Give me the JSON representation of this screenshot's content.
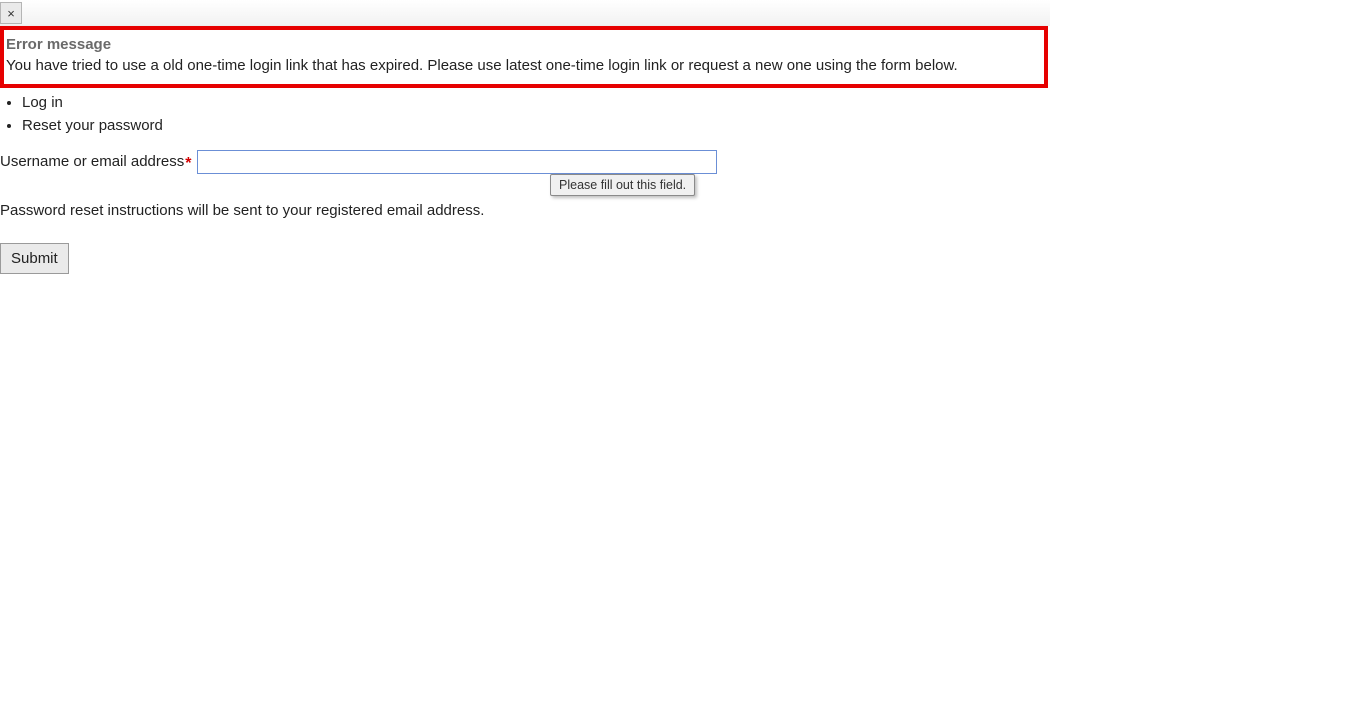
{
  "topbar": {
    "close_label": "×"
  },
  "error": {
    "title": "Error message",
    "body": "You have tried to use a old one-time login link that has expired. Please use latest one-time login link or request a new one using the form below."
  },
  "nav": {
    "items": [
      {
        "label": "Log in"
      },
      {
        "label": "Reset your password"
      }
    ]
  },
  "form": {
    "username_label": "Username or email address",
    "required_marker": "*",
    "username_value": "",
    "tooltip": "Please fill out this field.",
    "help_text": "Password reset instructions will be sent to your registered email address.",
    "submit_label": "Submit"
  }
}
